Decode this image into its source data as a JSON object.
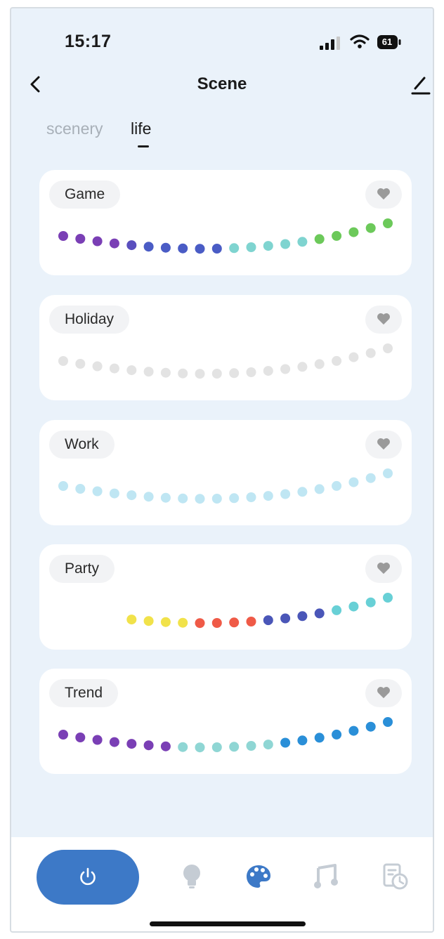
{
  "status_bar": {
    "time": "15:17",
    "battery": "61"
  },
  "header": {
    "title": "Scene",
    "back_icon": "chevron-left-icon",
    "edit_icon": "pencil-icon"
  },
  "tabs": [
    {
      "label": "scenery",
      "active": false
    },
    {
      "label": "life",
      "active": true
    }
  ],
  "scenes": [
    {
      "name": "Game",
      "favorite_icon": "heart-icon",
      "colors": [
        "#7a3fb5",
        "#7a3fb5",
        "#7a3fb5",
        "#7a3fb5",
        "#5a4fbe",
        "#4a5cc5",
        "#4a5cc5",
        "#4a5cc5",
        "#4a5cc5",
        "#4a5cc5",
        "#7fd4d0",
        "#7fd4d0",
        "#7fd4d0",
        "#7fd4d0",
        "#7fd4d0",
        "#6cc95a",
        "#6cc95a",
        "#6cc95a",
        "#6cc95a",
        "#6cc95a"
      ]
    },
    {
      "name": "Holiday",
      "favorite_icon": "heart-icon",
      "colors": [
        "#e3e3e3",
        "#e3e3e3",
        "#e3e3e3",
        "#e3e3e3",
        "#e3e3e3",
        "#e3e3e3",
        "#e3e3e3",
        "#e3e3e3",
        "#e3e3e3",
        "#e3e3e3",
        "#e3e3e3",
        "#e3e3e3",
        "#e3e3e3",
        "#e3e3e3",
        "#e3e3e3",
        "#e3e3e3",
        "#e3e3e3",
        "#e3e3e3",
        "#e3e3e3",
        "#e3e3e3"
      ]
    },
    {
      "name": "Work",
      "favorite_icon": "heart-icon",
      "colors": [
        "#bfe6f3",
        "#bfe6f3",
        "#bfe6f3",
        "#bfe6f3",
        "#bfe6f3",
        "#bfe6f3",
        "#bfe6f3",
        "#bfe6f3",
        "#bfe6f3",
        "#bfe6f3",
        "#bfe6f3",
        "#bfe6f3",
        "#bfe6f3",
        "#bfe6f3",
        "#bfe6f3",
        "#bfe6f3",
        "#bfe6f3",
        "#bfe6f3",
        "#bfe6f3",
        "#bfe6f3"
      ]
    },
    {
      "name": "Party",
      "favorite_icon": "heart-icon",
      "colors": [
        null,
        null,
        null,
        null,
        "#f1e24a",
        "#f1e24a",
        "#f1e24a",
        "#f1e24a",
        "#ef5a47",
        "#ef5a47",
        "#ef5a47",
        "#ef5a47",
        "#4a56b8",
        "#4a56b8",
        "#4a56b8",
        "#4a56b8",
        "#68d0d6",
        "#68d0d6",
        "#68d0d6",
        "#68d0d6"
      ]
    },
    {
      "name": "Trend",
      "favorite_icon": "heart-icon",
      "colors": [
        "#7a3fb5",
        "#7a3fb5",
        "#7a3fb5",
        "#7a3fb5",
        "#7a3fb5",
        "#7a3fb5",
        "#7a3fb5",
        "#8fd6d4",
        "#8fd6d4",
        "#8fd6d4",
        "#8fd6d4",
        "#8fd6d4",
        "#8fd6d4",
        "#2a8fd8",
        "#2a8fd8",
        "#2a8fd8",
        "#2a8fd8",
        "#2a8fd8",
        "#2a8fd8",
        "#2a8fd8"
      ]
    }
  ],
  "bottom_nav": {
    "power_icon": "power-icon",
    "items": [
      "bulb-icon",
      "palette-icon",
      "music-icon",
      "schedule-icon"
    ],
    "active_item": "palette-icon"
  },
  "colors": {
    "background": "#eaf2fa",
    "accent": "#3d79c7",
    "inactive_icon": "#c5ccd4"
  }
}
